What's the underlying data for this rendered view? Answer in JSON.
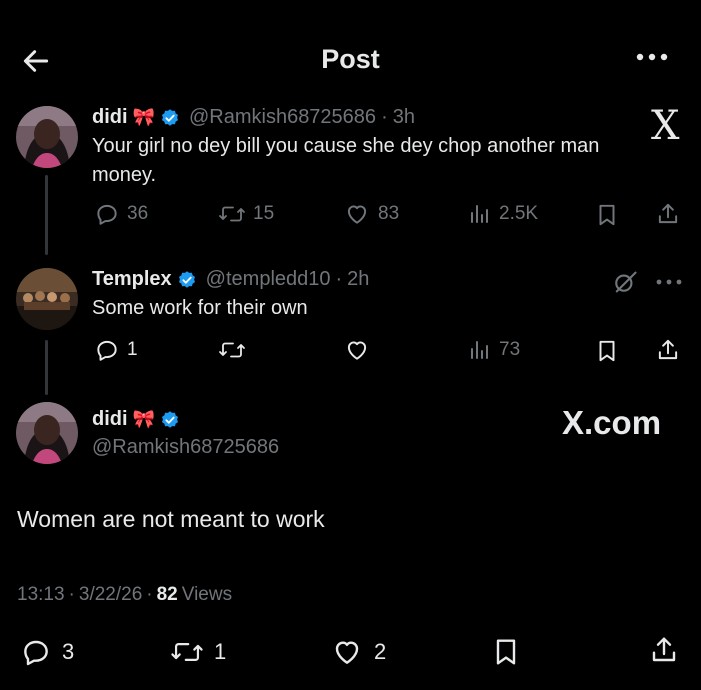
{
  "header": {
    "title": "Post"
  },
  "tweet1": {
    "name": "didi",
    "emoji": "🎀",
    "handle": "@Ramkish68725686",
    "time": "3h",
    "text": "Your girl no dey bill you cause she dey chop another man money.",
    "replies": "36",
    "reposts": "15",
    "likes": "83",
    "views": "2.5K",
    "x_logo": "X"
  },
  "tweet2": {
    "name": "Templex",
    "handle": "@templedd10",
    "time": "2h",
    "text": "Some work for their own",
    "replies": "1",
    "views": "73"
  },
  "main": {
    "name": "didi",
    "emoji": "🎀",
    "handle": "@Ramkish68725686",
    "watermark": "X.com",
    "text": "Women are not meant to work",
    "time": "13:13",
    "date": "3/22/26",
    "views_count": "82",
    "views_label": "Views",
    "replies": "3",
    "reposts": "1",
    "likes": "2"
  },
  "colors": {
    "background": "#000000",
    "text": "#e7e9ea",
    "muted": "#71767b",
    "verified": "#1d9bf0"
  }
}
